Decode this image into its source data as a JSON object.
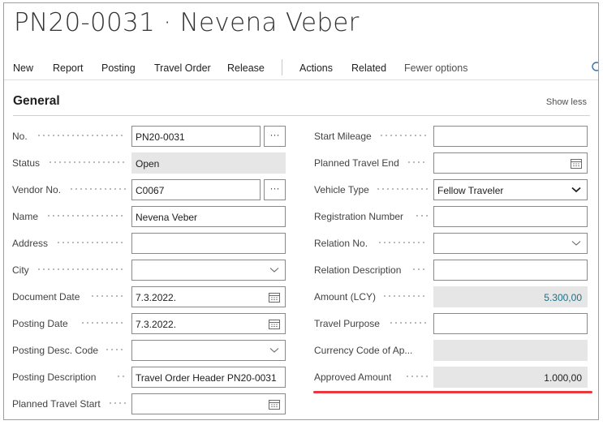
{
  "header": {
    "title": "PN20-0031 · Nevena Veber"
  },
  "actions": [
    {
      "label": "New"
    },
    {
      "label": "Report"
    },
    {
      "label": "Posting"
    },
    {
      "label": "Travel Order"
    },
    {
      "label": "Release"
    },
    {
      "label": "Actions"
    },
    {
      "label": "Related"
    },
    {
      "label": "Fewer options"
    }
  ],
  "section": {
    "title": "General",
    "toggle_label": "Show less"
  },
  "left_fields": [
    {
      "label": "No.",
      "value": "PN20-0031",
      "assist": "···"
    },
    {
      "label": "Status",
      "value": "Open"
    },
    {
      "label": "Vendor No.",
      "value": "C0067",
      "assist": "···"
    },
    {
      "label": "Name",
      "value": "Nevena Veber"
    },
    {
      "label": "Address",
      "value": ""
    },
    {
      "label": "City",
      "value": ""
    },
    {
      "label": "Document Date",
      "value": "7.3.2022."
    },
    {
      "label": "Posting Date",
      "value": "7.3.2022."
    },
    {
      "label": "Posting Desc. Code",
      "value": ""
    },
    {
      "label": "Posting Description",
      "value": "Travel Order Header PN20-0031"
    },
    {
      "label": "Planned Travel Start",
      "value": ""
    }
  ],
  "right_fields": [
    {
      "label": "Start Mileage",
      "value": ""
    },
    {
      "label": "Planned Travel End",
      "value": ""
    },
    {
      "label": "Vehicle Type",
      "value": "Fellow Traveler"
    },
    {
      "label": "Registration Number",
      "value": ""
    },
    {
      "label": "Relation No.",
      "value": ""
    },
    {
      "label": "Relation Description",
      "value": ""
    },
    {
      "label": "Amount (LCY)",
      "value": "5.300,00"
    },
    {
      "label": "Travel Purpose",
      "value": ""
    },
    {
      "label": "Currency Code of Ap...",
      "value": ""
    },
    {
      "label": "Approved Amount",
      "value": "1.000,00"
    }
  ],
  "colors": {
    "highlight": "#e8373d",
    "amount_link": "#1a7086",
    "readonly_bg": "#e6e6e6"
  }
}
